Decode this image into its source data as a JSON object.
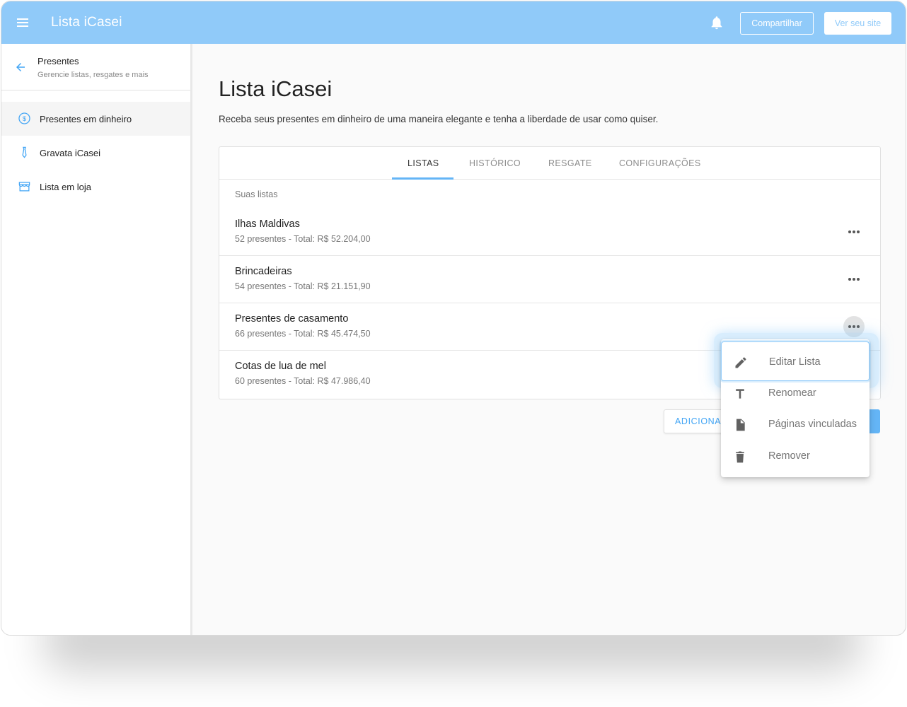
{
  "topbar": {
    "app_title": "Lista iCasei",
    "share_label": "Compartilhar",
    "view_site_label": "Ver seu site",
    "accent_color": "#90caf9"
  },
  "sidebar": {
    "title": "Presentes",
    "subtitle": "Gerencie listas, resgates e mais",
    "items": [
      {
        "label": "Presentes em dinheiro",
        "icon": "dollar-circle-icon"
      },
      {
        "label": "Gravata iCasei",
        "icon": "tie-icon"
      },
      {
        "label": "Lista em loja",
        "icon": "store-icon"
      }
    ]
  },
  "main": {
    "title": "Lista iCasei",
    "description": "Receba seus presentes em dinheiro de uma maneira elegante e tenha a liberdade de usar como quiser.",
    "tabs": [
      {
        "label": "LISTAS"
      },
      {
        "label": "HISTÓRICO"
      },
      {
        "label": "RESGATE"
      },
      {
        "label": "CONFIGURAÇÕES"
      }
    ],
    "section_label": "Suas listas",
    "lists": [
      {
        "name": "Ilhas Maldivas",
        "meta": "52 presentes - Total: R$ 52.204,00"
      },
      {
        "name": "Brincadeiras",
        "meta": "54 presentes - Total: R$ 21.151,90"
      },
      {
        "name": "Presentes de casamento",
        "meta": "66 presentes - Total: R$ 45.474,50"
      },
      {
        "name": "Cotas de lua de mel",
        "meta": "60 presentes - Total: R$ 47.986,40"
      }
    ],
    "add_button_label": "ADICIONAR"
  },
  "menu": {
    "items": [
      {
        "label": "Editar Lista",
        "icon": "pencil-icon"
      },
      {
        "label": "Renomear",
        "icon": "text-icon"
      },
      {
        "label": "Páginas vinculadas",
        "icon": "file-icon"
      },
      {
        "label": "Remover",
        "icon": "trash-icon"
      }
    ]
  }
}
